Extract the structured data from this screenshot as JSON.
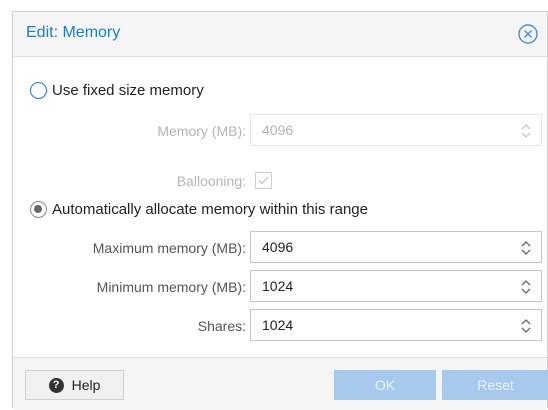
{
  "dialog": {
    "title": "Edit: Memory"
  },
  "fixed_option": {
    "label": "Use fixed size memory",
    "selected": false,
    "memory_label": "Memory (MB):",
    "memory_value": "4096",
    "ballooning_label": "Ballooning:",
    "ballooning_checked": true
  },
  "auto_option": {
    "label": "Automatically allocate memory within this range",
    "selected": true,
    "max_label": "Maximum memory (MB):",
    "max_value": "4096",
    "min_label": "Minimum memory (MB):",
    "min_value": "1024",
    "shares_label": "Shares:",
    "shares_value": "1024"
  },
  "footer": {
    "help_label": "Help",
    "help_icon": "?",
    "ok_label": "OK",
    "reset_label": "Reset"
  },
  "colors": {
    "accent": "#157fcc",
    "button_disabled": "#a6c9ec"
  }
}
